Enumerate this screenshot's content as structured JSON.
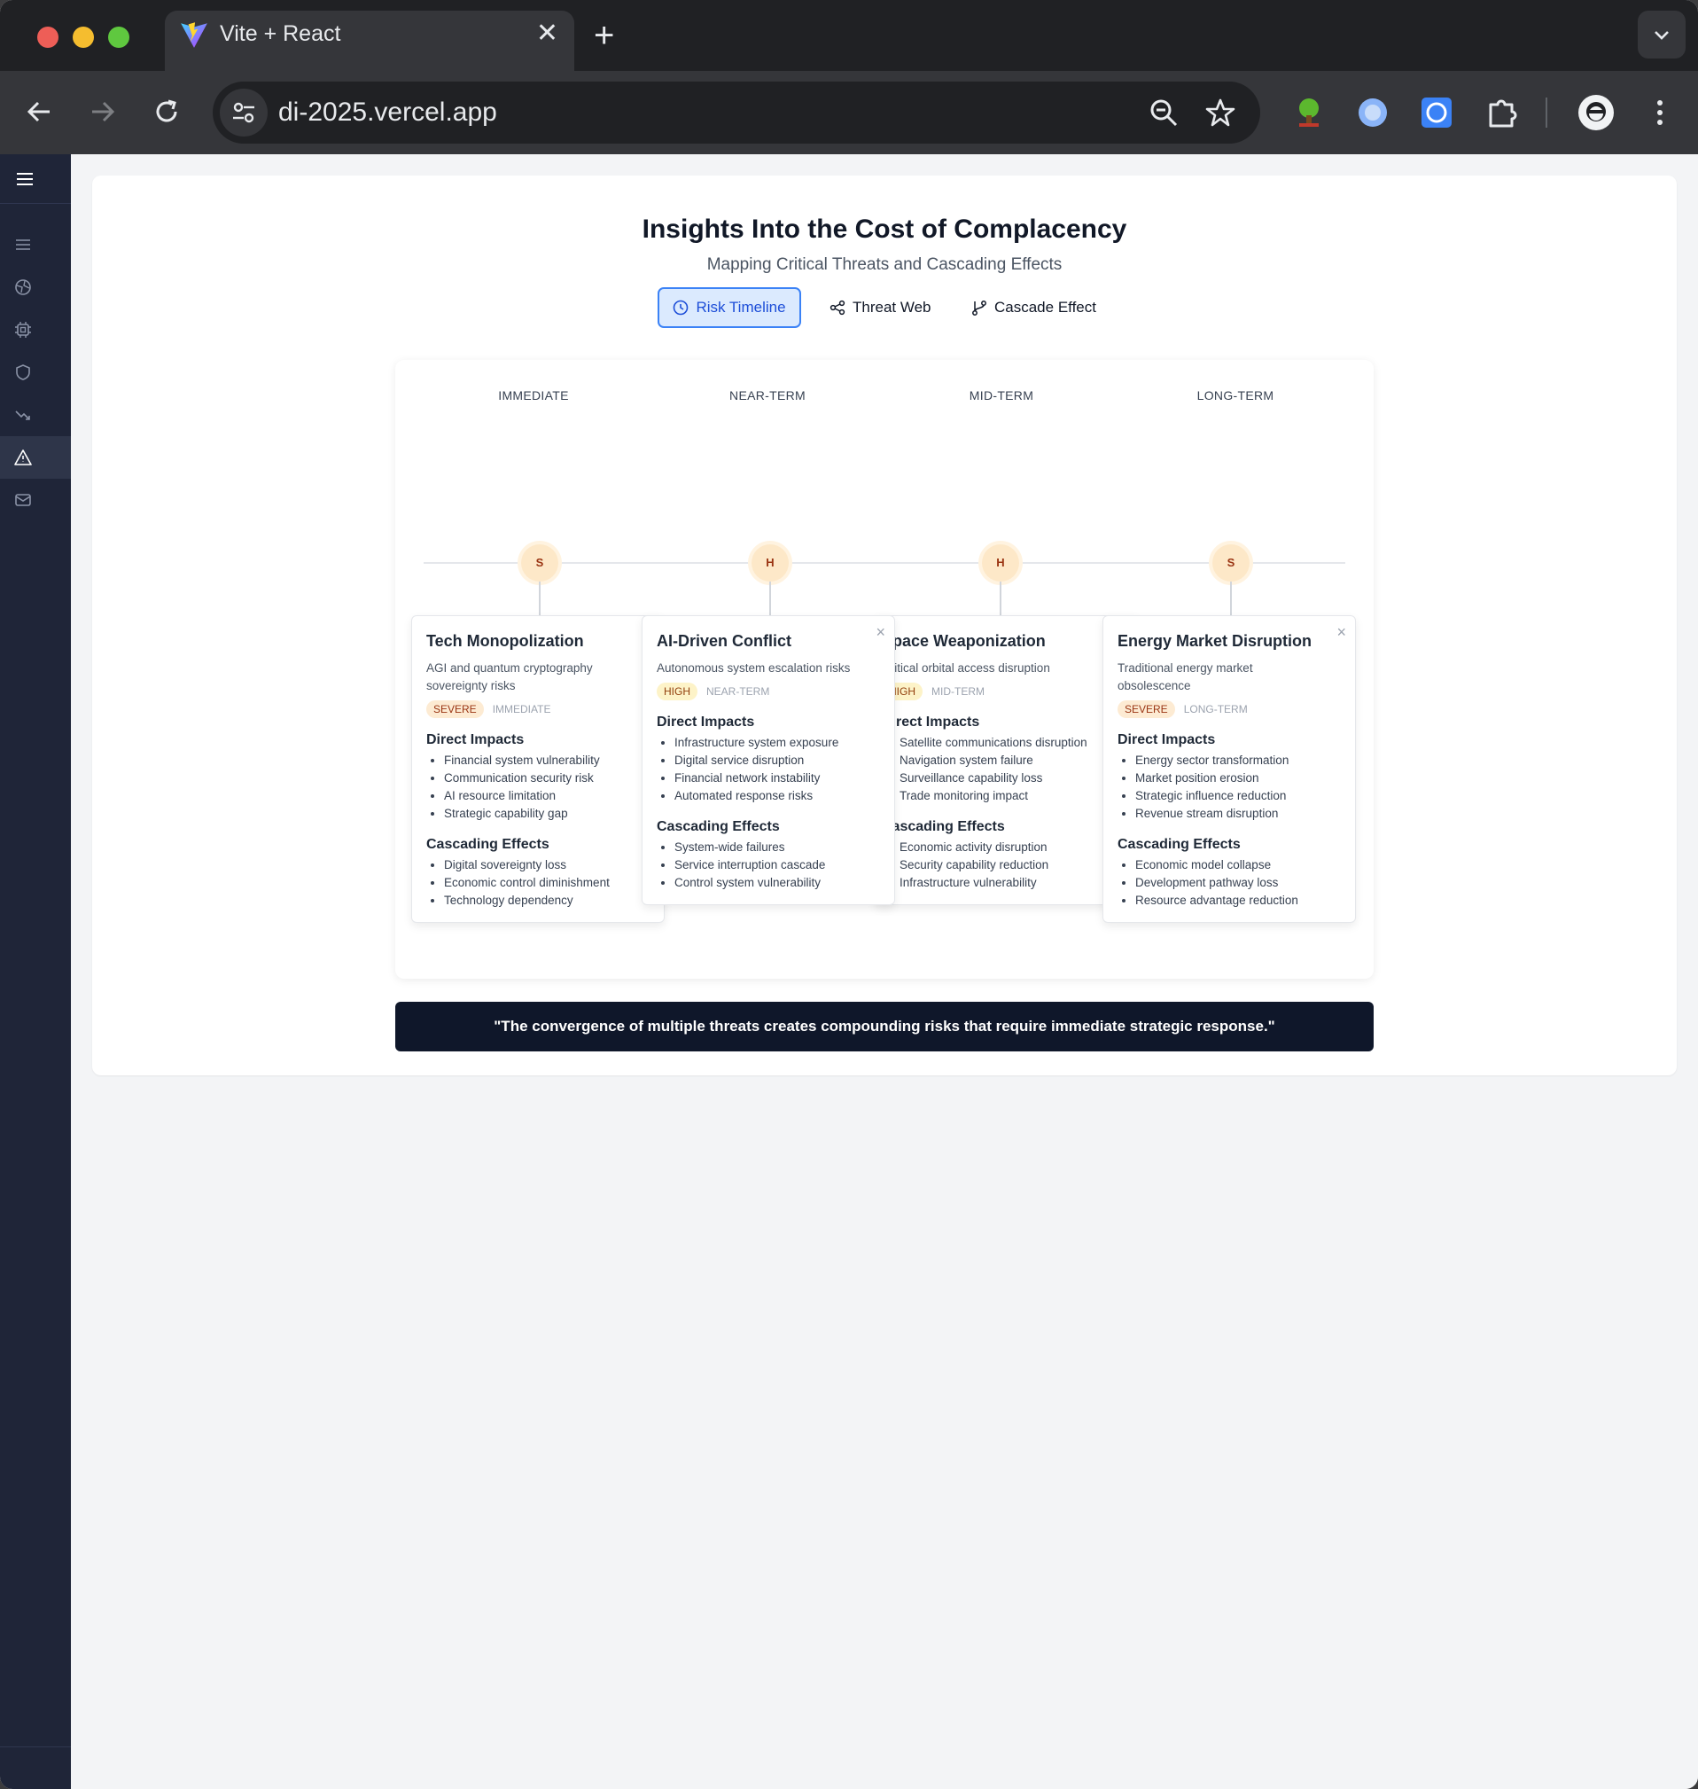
{
  "browser": {
    "tab_title": "Vite + React",
    "url": "di-2025.vercel.app"
  },
  "page": {
    "title": "Insights Into the Cost of Complacency",
    "subtitle": "Mapping Critical Threats and Cascading Effects"
  },
  "view_tabs": [
    {
      "label": "Risk Timeline",
      "icon": "clock-icon",
      "active": true
    },
    {
      "label": "Threat Web",
      "icon": "share-icon",
      "active": false
    },
    {
      "label": "Cascade Effect",
      "icon": "git-branch-icon",
      "active": false
    }
  ],
  "timeline": {
    "columns": [
      "IMMEDIATE",
      "NEAR-TERM",
      "MID-TERM",
      "LONG-TERM"
    ],
    "nodes": [
      "S",
      "H",
      "H",
      "S"
    ],
    "section_labels": {
      "direct": "Direct Impacts",
      "cascading": "Cascading Effects"
    },
    "risks": [
      {
        "title": "Tech Monopolization",
        "description": "AGI and quantum cryptography sovereignty risks",
        "severity": "SEVERE",
        "term": "IMMEDIATE",
        "direct": [
          "Financial system vulnerability",
          "Communication security risk",
          "AI resource limitation",
          "Strategic capability gap"
        ],
        "cascading": [
          "Digital sovereignty loss",
          "Economic control diminishment",
          "Technology dependency"
        ]
      },
      {
        "title": "AI-Driven Conflict",
        "description": "Autonomous system escalation risks",
        "severity": "HIGH",
        "term": "NEAR-TERM",
        "close": "×",
        "direct": [
          "Infrastructure system exposure",
          "Digital service disruption",
          "Financial network instability",
          "Automated response risks"
        ],
        "cascading": [
          "System-wide failures",
          "Service interruption cascade",
          "Control system vulnerability"
        ]
      },
      {
        "title": "Space Weaponization",
        "description": "Critical orbital access disruption",
        "severity": "HIGH",
        "term": "MID-TERM",
        "direct": [
          "Satellite communications disruption",
          "Navigation system failure",
          "Surveillance capability loss",
          "Trade monitoring impact"
        ],
        "cascading": [
          "Economic activity disruption",
          "Security capability reduction",
          "Infrastructure vulnerability"
        ]
      },
      {
        "title": "Energy Market Disruption",
        "description": "Traditional energy market obsolescence",
        "severity": "SEVERE",
        "term": "LONG-TERM",
        "close": "×",
        "direct": [
          "Energy sector transformation",
          "Market position erosion",
          "Strategic influence reduction",
          "Revenue stream disruption"
        ],
        "cascading": [
          "Economic model collapse",
          "Development pathway loss",
          "Resource advantage reduction"
        ]
      }
    ]
  },
  "quote": "\"The convergence of multiple threats creates compounding risks that require immediate strategic response.\"",
  "colors": {
    "sidebar": "#1f2538",
    "accent": "#3b82f6",
    "quote_bg": "#0f172a",
    "severity_bg": "#fdebd3"
  }
}
